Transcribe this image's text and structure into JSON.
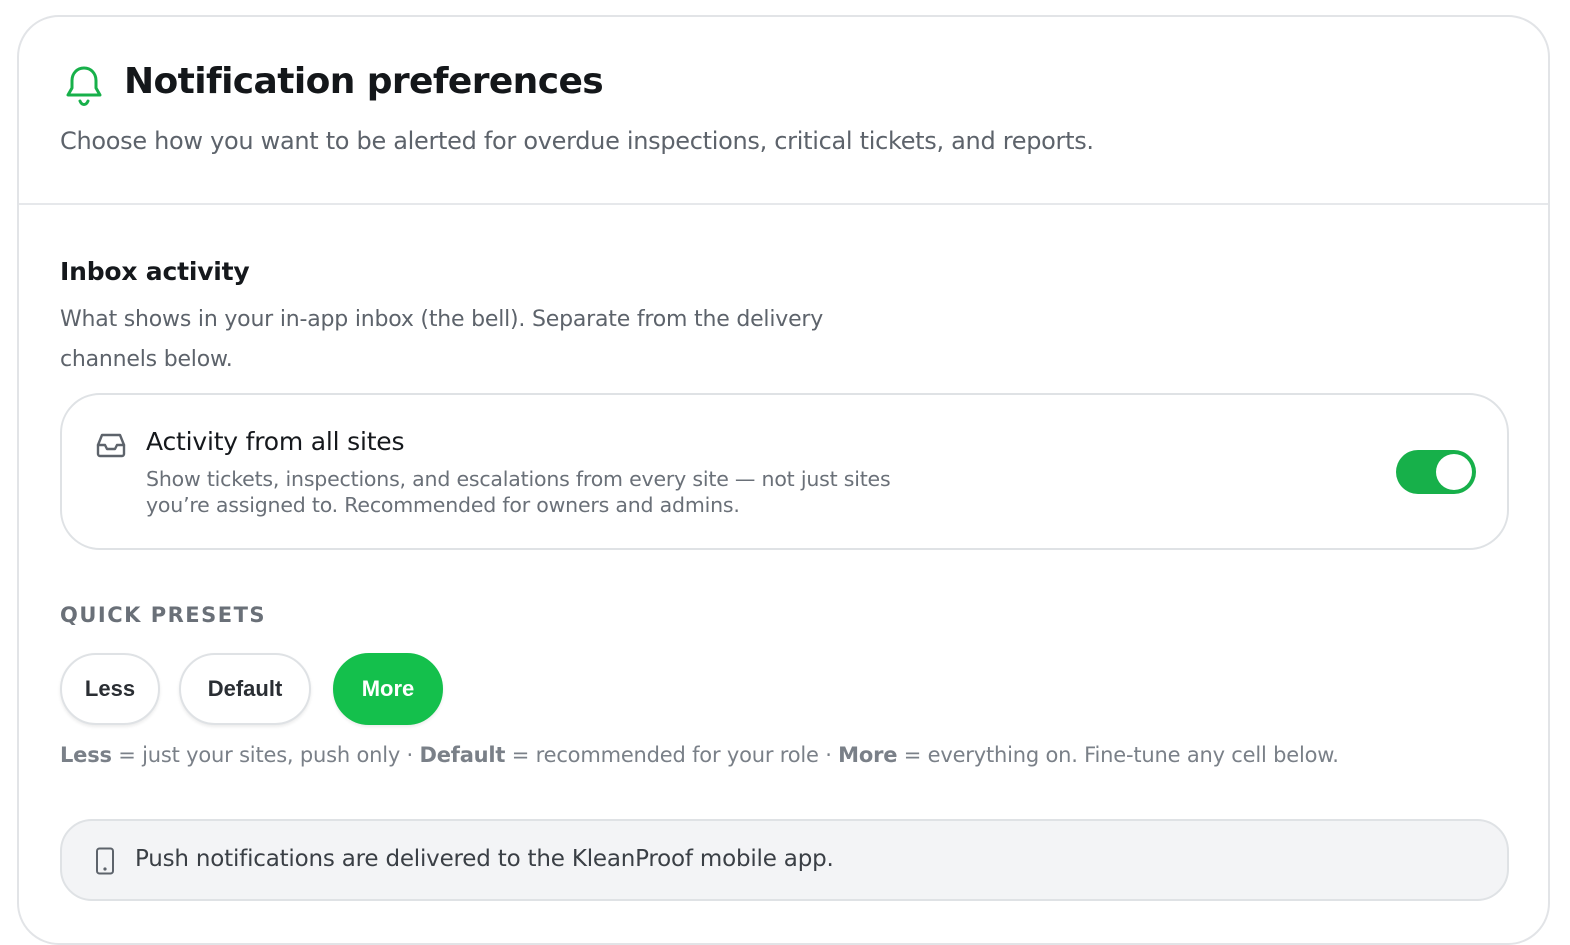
{
  "header": {
    "title": "Notification preferences",
    "subtitle": "Choose how you want to be alerted for overdue inspections, critical tickets, and reports.",
    "icon": "bell-icon",
    "accent_color": "#17b04a"
  },
  "inbox": {
    "title": "Inbox activity",
    "description": "What shows in your in-app inbox (the bell). Separate from the delivery channels below.",
    "setting": {
      "icon": "inbox-icon",
      "title": "Activity from all sites",
      "description": "Show tickets, inspections, and escalations from every site — not just sites you’re assigned to. Recommended for owners and admins.",
      "enabled": true
    }
  },
  "presets": {
    "label": "QUICK PRESETS",
    "options": [
      "Less",
      "Default",
      "More"
    ],
    "selected": "More",
    "help": {
      "less_term": "Less",
      "less_text": " = just your sites, push only · ",
      "default_term": "Default",
      "default_text": " = recommended for your role · ",
      "more_term": "More",
      "more_text": " = everything on. Fine-tune any cell below."
    }
  },
  "push_banner": {
    "icon": "phone-icon",
    "text": "Push notifications are delivered to the KleanProof mobile app."
  }
}
